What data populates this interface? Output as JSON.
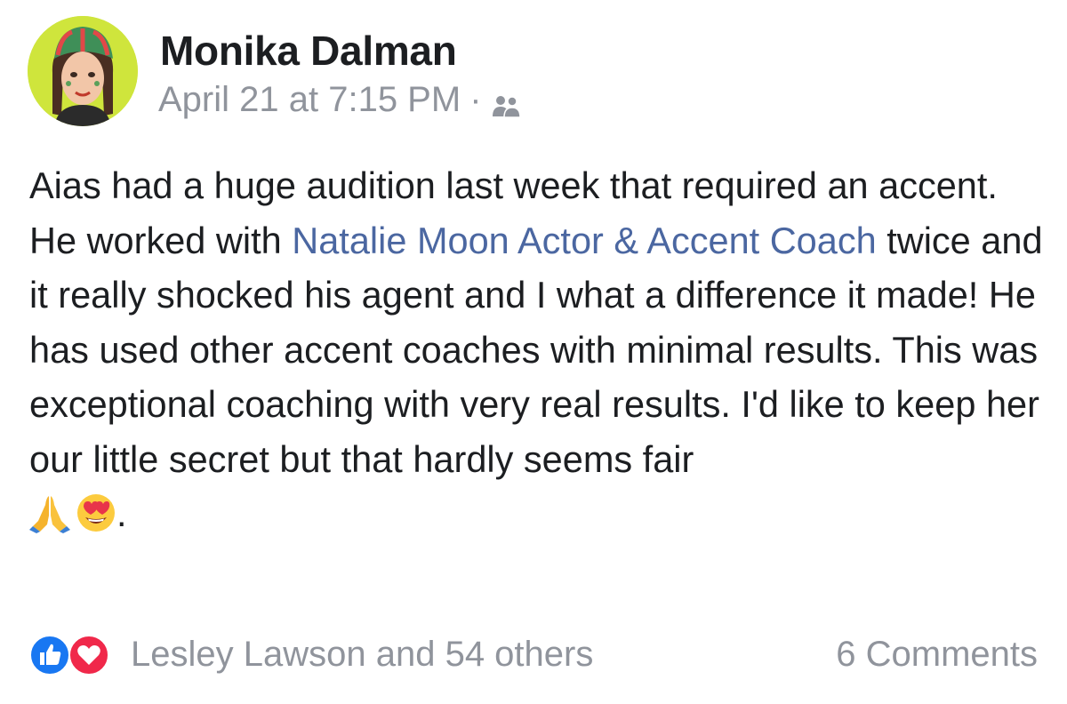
{
  "post": {
    "author": "Monika Dalman",
    "timestamp": "April 21 at 7:15 PM",
    "separator": "·",
    "audience_icon": "friends-icon",
    "text_parts": {
      "before_mention": "Aias had a huge audition last week that required an accent. He worked with ",
      "mention": "Natalie Moon Actor & Accent Coach",
      "after_mention": " twice and it really shocked his agent and I what a difference it made! He has used other accent coaches with minimal results. This was exceptional coaching with very real results. I'd like to keep her our little secret but that hardly seems fair ",
      "emojis": [
        "folded-hands-emoji",
        "heart-eyes-emoji"
      ],
      "ending": "."
    },
    "reactions": {
      "icons": [
        "like-reaction-icon",
        "love-reaction-icon"
      ],
      "summary": "Lesley Lawson and 54 others"
    },
    "comments": "6 Comments"
  },
  "colors": {
    "name": "#1c1e21",
    "meta": "#90949c",
    "mention": "#4b67a1",
    "like": "#1877f2",
    "love": "#f0284a"
  }
}
